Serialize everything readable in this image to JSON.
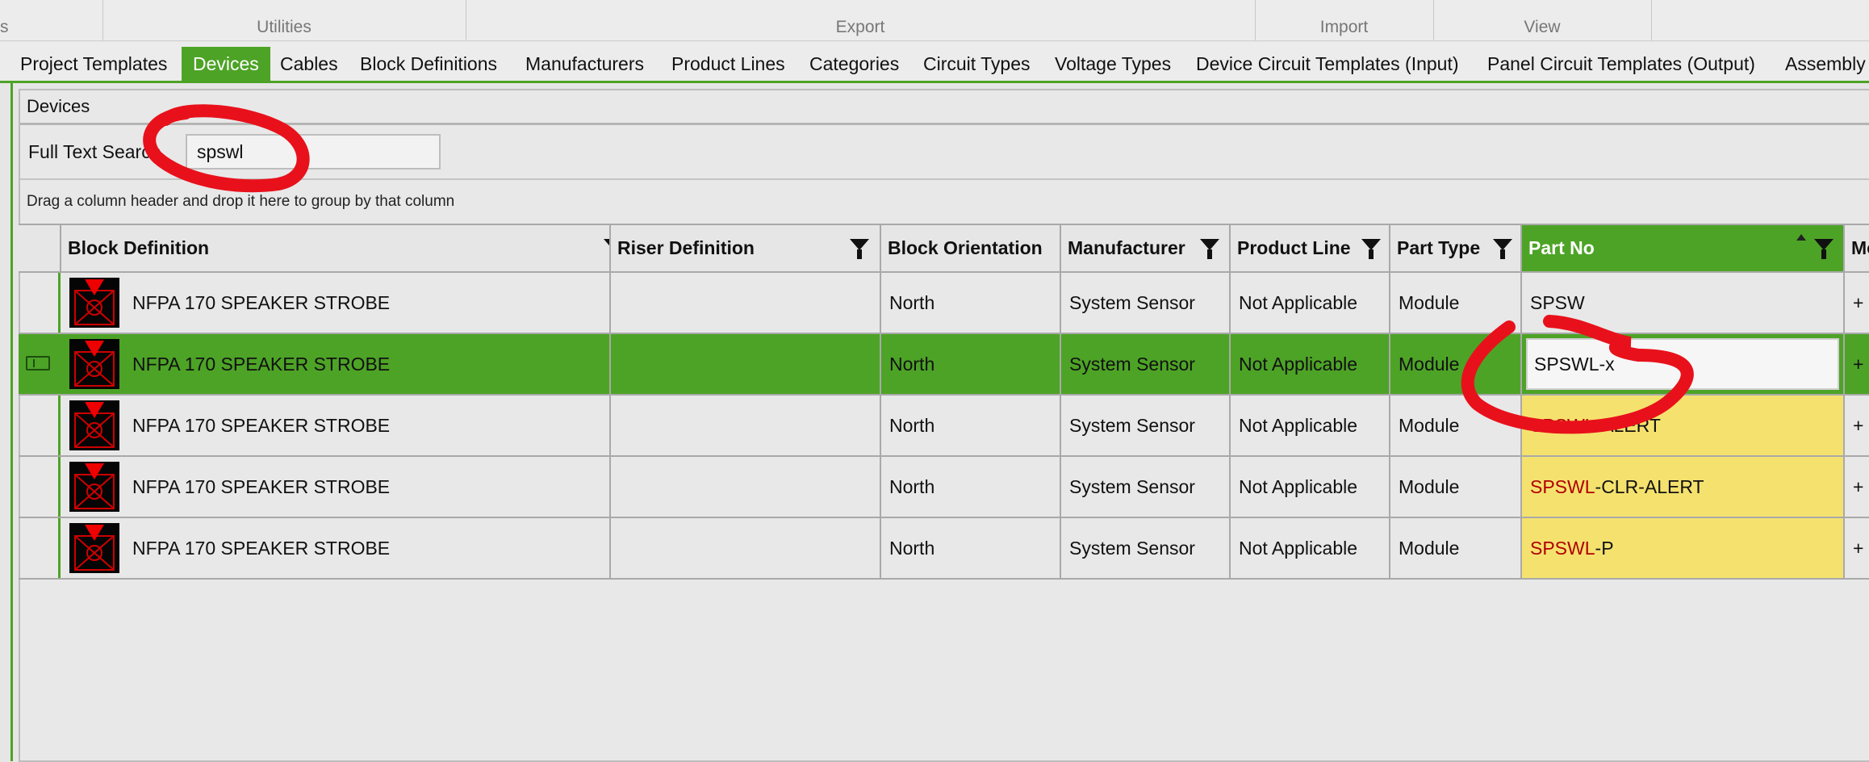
{
  "ribbon": {
    "groups": [
      "s",
      "Utilities",
      "Export",
      "Import",
      "View"
    ]
  },
  "tabs": [
    {
      "label": "Project Templates",
      "active": false
    },
    {
      "label": "Devices",
      "active": true
    },
    {
      "label": "Cables",
      "active": false
    },
    {
      "label": "Block Definitions",
      "active": false
    },
    {
      "label": "Manufacturers",
      "active": false
    },
    {
      "label": "Product Lines",
      "active": false
    },
    {
      "label": "Categories",
      "active": false
    },
    {
      "label": "Circuit Types",
      "active": false
    },
    {
      "label": "Voltage Types",
      "active": false
    },
    {
      "label": "Device Circuit Templates (Input)",
      "active": false
    },
    {
      "label": "Panel Circuit Templates (Output)",
      "active": false
    },
    {
      "label": "Assembly",
      "active": false
    }
  ],
  "devices": {
    "title": "Devices",
    "search_label": "Full Text Search",
    "search_value": "spswl",
    "group_hint": "Drag a column header and drop it here to group by that column"
  },
  "grid": {
    "columns": [
      "Block Definition",
      "Riser Definition",
      "Block Orientation",
      "Manufacturer",
      "Product Line",
      "Part Type",
      "Part No",
      "Moc"
    ],
    "rows": [
      {
        "block": "NFPA 170 SPEAKER STROBE",
        "riser": "",
        "orientation": "North",
        "manufacturer": "System Sensor",
        "product_line": "Not Applicable",
        "part_type": "Module",
        "part_hl": "",
        "part_rest": "SPSW",
        "last": "+"
      },
      {
        "block": "NFPA 170 SPEAKER STROBE",
        "riser": "",
        "orientation": "North",
        "manufacturer": "System Sensor",
        "product_line": "Not Applicable",
        "part_type": "Module",
        "part_edit": "SPSWL-x",
        "last": "+"
      },
      {
        "block": "NFPA 170 SPEAKER STROBE",
        "riser": "",
        "orientation": "North",
        "manufacturer": "System Sensor",
        "product_line": "Not Applicable",
        "part_type": "Module",
        "part_hl": "SPSWL",
        "part_rest": "-ALERT",
        "last": "+"
      },
      {
        "block": "NFPA 170 SPEAKER STROBE",
        "riser": "",
        "orientation": "North",
        "manufacturer": "System Sensor",
        "product_line": "Not Applicable",
        "part_type": "Module",
        "part_hl": "SPSWL",
        "part_rest": "-CLR-ALERT",
        "last": "+"
      },
      {
        "block": "NFPA 170 SPEAKER STROBE",
        "riser": "",
        "orientation": "North",
        "manufacturer": "System Sensor",
        "product_line": "Not Applicable",
        "part_type": "Module",
        "part_hl": "SPSWL",
        "part_rest": "-P",
        "last": "+"
      }
    ]
  },
  "colors": {
    "accent": "#4da326",
    "match_highlight": "#f5e26e",
    "match_text": "#b00000",
    "annotation": "#e8111b"
  },
  "icons": {
    "filter": "funnel-icon",
    "sort": "sort-ascending-icon",
    "edit_row": "row-edit-icon",
    "block_thumb": "speaker-strobe-icon"
  }
}
